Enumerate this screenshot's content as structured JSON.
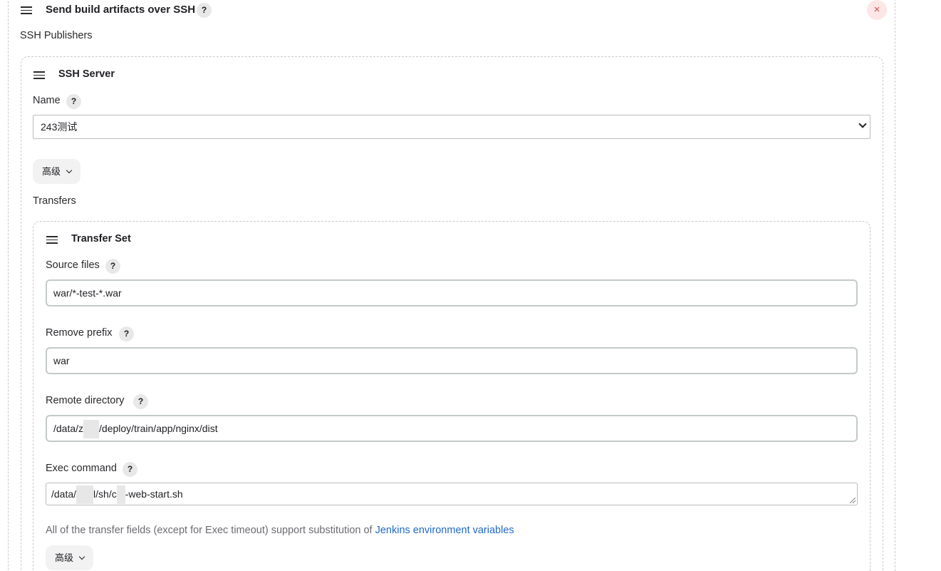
{
  "section": {
    "title": "Send build artifacts over SSH",
    "help": "?",
    "close": "×",
    "publishers_label": "SSH Publishers"
  },
  "server": {
    "title": "SSH Server",
    "name_label": "Name",
    "name_value": "243测试",
    "advanced_label": "高级",
    "transfers_label": "Transfers"
  },
  "transfer": {
    "title": "Transfer Set",
    "source_label": "Source files",
    "source_value": "war/*-test-*.war",
    "prefix_label": "Remove prefix",
    "prefix_value": "war",
    "remote_label": "Remote directory",
    "remote_value_a": "/data/z",
    "remote_value_b": "/deploy/train/app/nginx/dist",
    "exec_label": "Exec command",
    "exec_value_a": "/data/",
    "exec_value_b": "l/sh/c",
    "exec_value_c": "-web-start.sh",
    "note_text": "All of the transfer fields (except for Exec timeout) support substitution of ",
    "note_link": "Jenkins environment variables",
    "advanced_label": "高级"
  }
}
